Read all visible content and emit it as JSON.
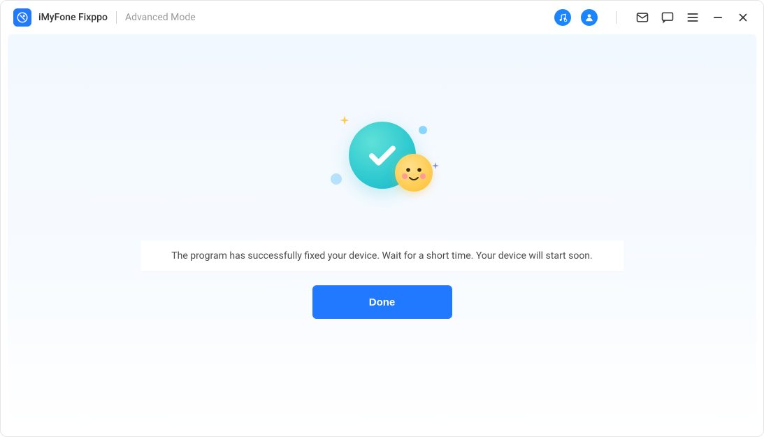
{
  "app": {
    "name": "iMyFone Fixppo",
    "mode": "Advanced Mode"
  },
  "titlebar_icons": {
    "music": "music-search-icon",
    "account": "account-icon",
    "mail": "mail-icon",
    "feedback": "feedback-icon",
    "menu": "menu-icon",
    "minimize": "minimize-icon",
    "close": "close-icon"
  },
  "main": {
    "message": "The program has successfully fixed your device. Wait for a short time. Your device will start soon.",
    "done_label": "Done"
  }
}
